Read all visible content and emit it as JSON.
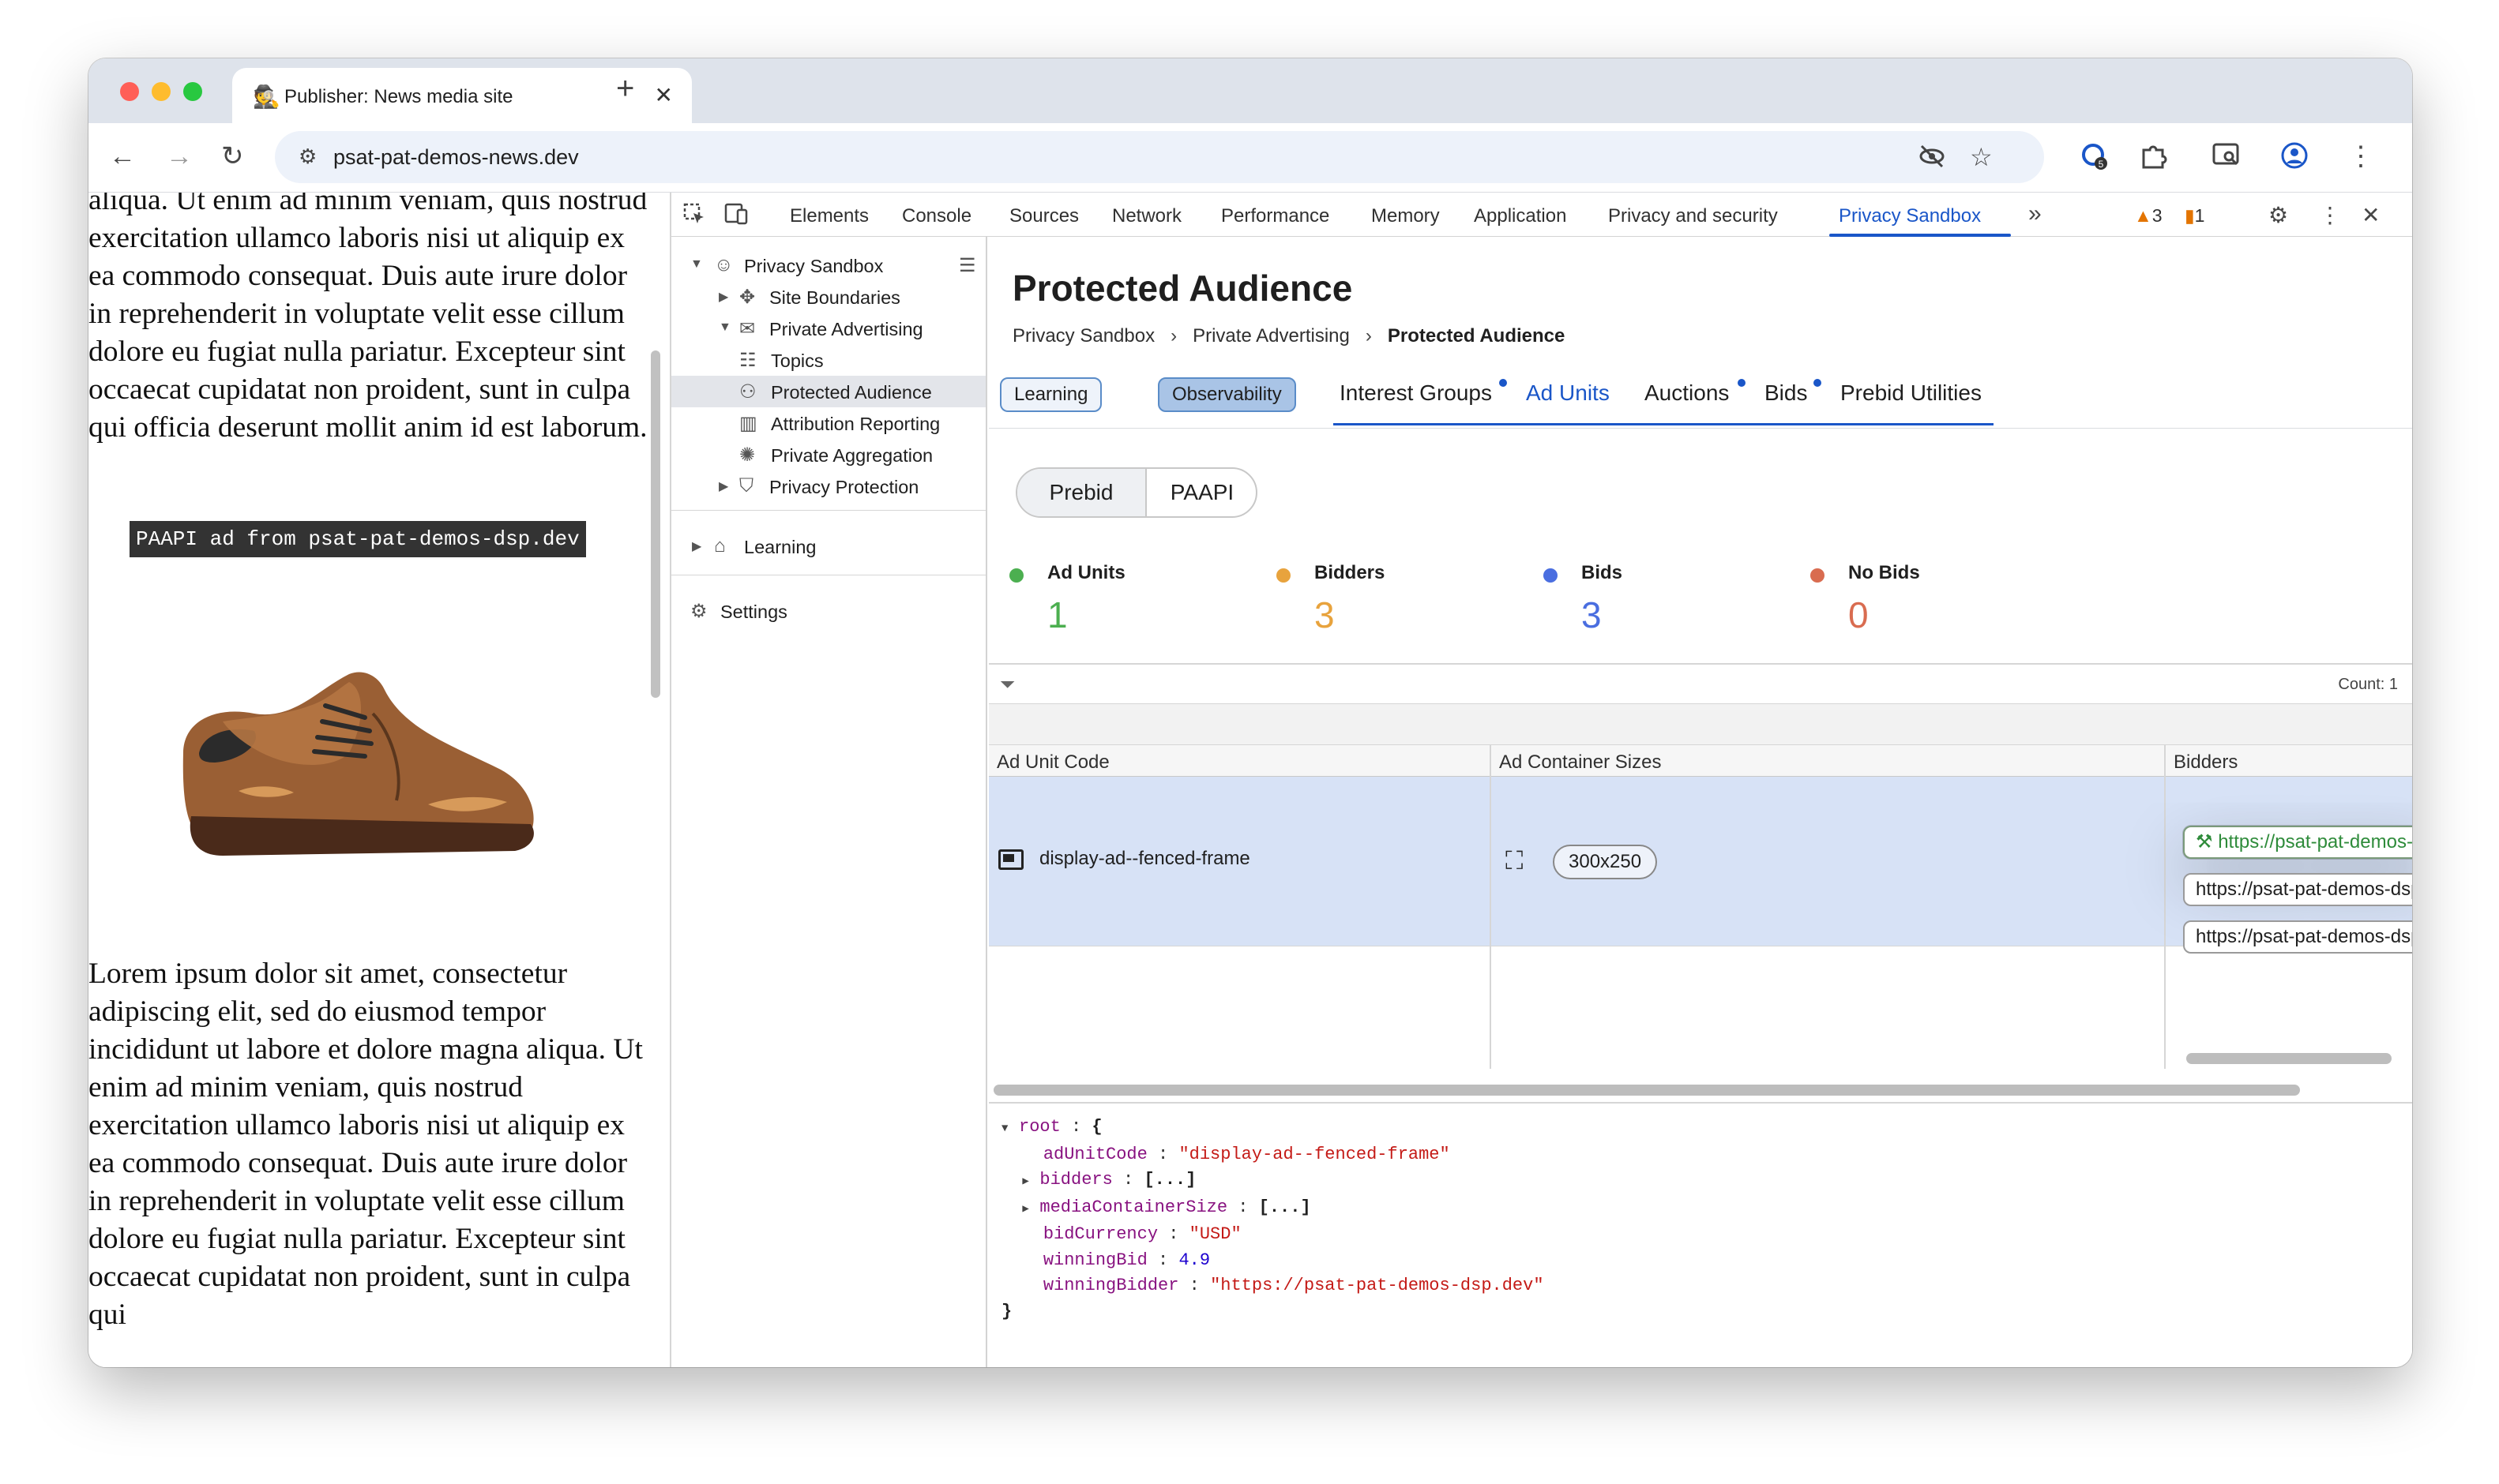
{
  "browser": {
    "tab_title": "Publisher: News media site",
    "url": "psat-pat-demos-news.dev"
  },
  "page": {
    "paragraph_top": "aliqua. Ut enim ad minim veniam, quis nostrud exercitation ullamco laboris nisi ut aliquip ex ea commodo consequat. Duis aute irure dolor in reprehenderit in voluptate velit esse cillum dolore eu fugiat nulla pariatur. Excepteur sint occaecat cupidatat non proident, sunt in culpa qui officia deserunt mollit anim id est laborum.",
    "ad_label": "PAAPI ad from psat-pat-demos-dsp.dev",
    "paragraph_bottom": "Lorem ipsum dolor sit amet, consectetur adipiscing elit, sed do eiusmod tempor incididunt ut labore et dolore magna aliqua. Ut enim ad minim veniam, quis nostrud exercitation ullamco laboris nisi ut aliquip ex ea commodo consequat. Duis aute irure dolor in reprehenderit in voluptate velit esse cillum dolore eu fugiat nulla pariatur. Excepteur sint occaecat cupidatat non proident, sunt in culpa qui"
  },
  "devtools": {
    "tabs": [
      "Elements",
      "Console",
      "Sources",
      "Network",
      "Performance",
      "Memory",
      "Application",
      "Privacy and security",
      "Privacy Sandbox"
    ],
    "warnings": "3",
    "errors": "1",
    "sidebar": {
      "privacy_sandbox": "Privacy Sandbox",
      "site_boundaries": "Site Boundaries",
      "private_advertising": "Private Advertising",
      "topics": "Topics",
      "protected_audience": "Protected Audience",
      "attribution_reporting": "Attribution Reporting",
      "private_aggregation": "Private Aggregation",
      "privacy_protection": "Privacy Protection",
      "learning": "Learning",
      "settings": "Settings"
    },
    "main": {
      "title": "Protected Audience",
      "breadcrumb": [
        "Privacy Sandbox",
        "Private Advertising",
        "Protected Audience"
      ],
      "pill_learning": "Learning",
      "pill_observability": "Observability",
      "subtabs": [
        "Interest Groups",
        "Ad Units",
        "Auctions",
        "Bids",
        "Prebid Utilities"
      ],
      "segment": [
        "Prebid",
        "PAAPI"
      ],
      "stats": [
        {
          "label": "Ad Units",
          "value": "1",
          "color": "#4caf50"
        },
        {
          "label": "Bidders",
          "value": "3",
          "color": "#e8a33d"
        },
        {
          "label": "Bids",
          "value": "3",
          "color": "#4a6ee0"
        },
        {
          "label": "No Bids",
          "value": "0",
          "color": "#d96c50"
        }
      ],
      "count": "Count: 1",
      "columns": [
        "Ad Unit Code",
        "Ad Container Sizes",
        "Bidders"
      ],
      "row": {
        "ad_unit_code": "display-ad--fenced-frame",
        "size": "300x250",
        "bidders": [
          "https://psat-pat-demos-dsp.dev",
          "https://psat-pat-demos-dsp-a.dev",
          "https://psat-pat-demos-dsp-b.dev"
        ]
      },
      "json": {
        "root": "root",
        "adUnitCode_key": "adUnitCode",
        "adUnitCode_val": "\"display-ad--fenced-frame\"",
        "bidders_key": "bidders",
        "collapsed": "[...]",
        "mediaContainerSize_key": "mediaContainerSize",
        "bidCurrency_key": "bidCurrency",
        "bidCurrency_val": "\"USD\"",
        "winningBid_key": "winningBid",
        "winningBid_val": "4.9",
        "winningBidder_key": "winningBidder",
        "winningBidder_val": "\"https://psat-pat-demos-dsp.dev\""
      }
    }
  }
}
